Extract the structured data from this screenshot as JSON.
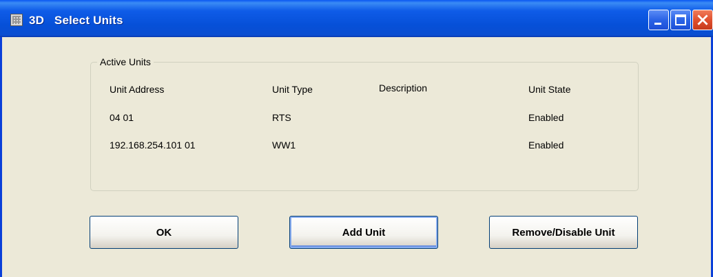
{
  "window": {
    "title": "3D   Select Units",
    "title_icon": "table-icon",
    "accent_color": "#0a58f2"
  },
  "group": {
    "label": "Active Units",
    "columns": [
      "Unit Address",
      "Unit Type",
      "Description",
      "Unit State"
    ],
    "rows": [
      [
        "04 01",
        "RTS",
        "",
        "Enabled"
      ],
      [
        "192.168.254.101 01",
        "WW1",
        "",
        "Enabled"
      ]
    ]
  },
  "buttons": {
    "ok": "OK",
    "add_unit": "Add Unit",
    "remove_disable": "Remove/Disable Unit"
  },
  "title_buttons": {
    "minimize_icon": "minimize-icon",
    "maximize_icon": "maximize-icon",
    "close_icon": "close-icon"
  }
}
